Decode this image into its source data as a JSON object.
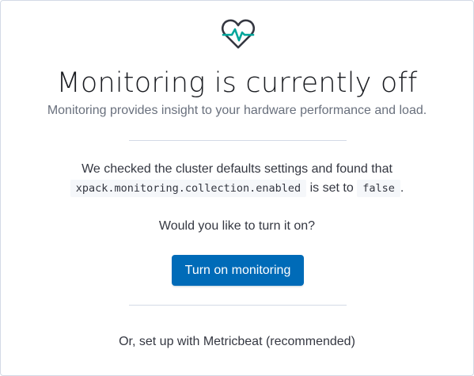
{
  "icon": {
    "name": "monitoring-heart-icon",
    "outline_color": "#343741",
    "pulse_color": "#00a69b"
  },
  "header": {
    "title": "Monitoring is currently off",
    "subtitle": "Monitoring provides insight to your hardware performance and load."
  },
  "explanation": {
    "text_before": "We checked the cluster defaults settings and found that",
    "setting_name": "xpack.monitoring.collection.enabled",
    "text_middle": "is set to",
    "setting_value": "false",
    "text_end": "."
  },
  "prompt": {
    "question": "Would you like to turn it on?"
  },
  "actions": {
    "turn_on_label": "Turn on monitoring",
    "metricbeat_label": "Or, set up with Metricbeat (recommended)"
  },
  "colors": {
    "primary": "#006bb8",
    "border": "#d3dae6",
    "code_bg": "#f5f7fa"
  }
}
